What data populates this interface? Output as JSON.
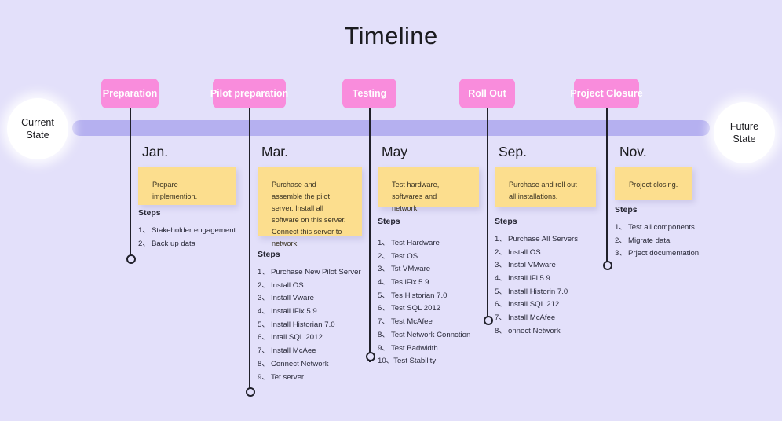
{
  "page": {
    "title": "Timeline",
    "background_color": "#E3E0FA",
    "spine_color": "#B5B0F0",
    "phase_color": "#F98CDC",
    "note_color": "#FCDE8E"
  },
  "endpoints": {
    "start": {
      "line1": "Current",
      "line2": "State"
    },
    "end": {
      "line1": "Future",
      "line2": "State"
    }
  },
  "steps_heading": "Steps",
  "phases": [
    {
      "label": "Preparation"
    },
    {
      "label": "Pilot preparation"
    },
    {
      "label": "Testing"
    },
    {
      "label": "Roll Out"
    },
    {
      "label": "Project Closure"
    }
  ],
  "columns": [
    {
      "month": "Jan.",
      "note": "Prepare implemention.",
      "steps": [
        "Stakeholder engagement",
        "Back up data"
      ]
    },
    {
      "month": "Mar.",
      "note": "Purchase and assemble the pilot server. Install all software on this server. Connect this server to network.",
      "steps": [
        "Purchase New Pilot Server",
        " Install OS",
        "Install Vware",
        "Install iFix 5.9",
        "Install Historian 7.0",
        "Intall SQL 2012",
        "Install McAee",
        "Connect Network",
        "Tet server"
      ]
    },
    {
      "month": "May",
      "note": "Test hardware, softwares and network.",
      "steps": [
        "Test Hardware",
        "Test OS",
        "Tst VMware",
        "Tes iFix 5.9",
        "Tes Historian 7.0",
        "Test SQL 2012",
        "Test McAfee",
        "Test Network Connction",
        "Test Badwidth",
        "Test Stability"
      ]
    },
    {
      "month": "Sep.",
      "note": "Purchase and roll out all installations.",
      "steps": [
        "Purchase All Servers",
        "Install OS",
        "Instal VMware",
        "Install iFi 5.9",
        "Install Historin 7.0",
        "Install SQL 212",
        "Install McAfee",
        "onnect Network"
      ]
    },
    {
      "month": "Nov.",
      "note": "Project closing.",
      "steps": [
        "Test all components",
        "Migrate data",
        "Prject documentation"
      ]
    }
  ]
}
